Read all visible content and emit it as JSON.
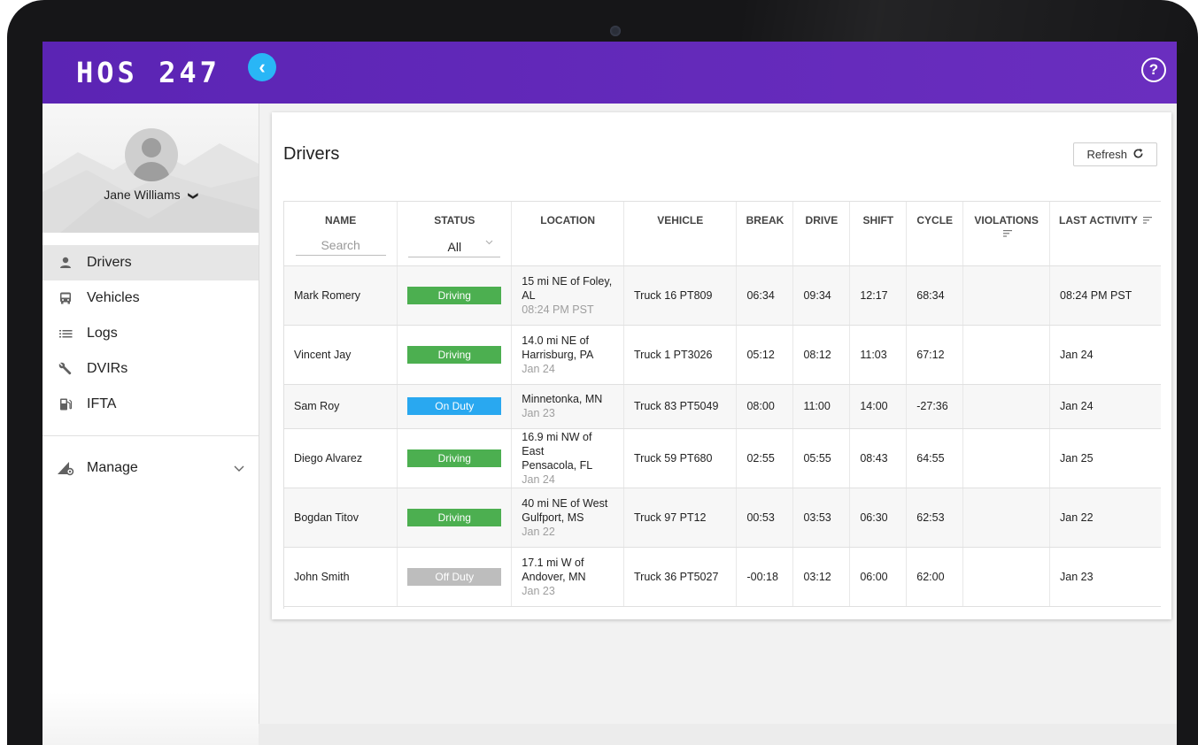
{
  "app": {
    "logo": "HOS 247",
    "colors": {
      "topbar": "#5b24b4",
      "accent": "#29b6f6",
      "driving": "#4caf50",
      "on_duty": "#29a8f0",
      "off_duty": "#bdbdbd"
    }
  },
  "topbar": {
    "collapse_icon": "chevron-left-icon",
    "help_icon": "help-circle-icon",
    "help_glyph": "?"
  },
  "sidebar": {
    "user": {
      "name": "Jane Williams",
      "chevron": "❯"
    },
    "items": [
      {
        "label": "Drivers",
        "icon": "person-icon",
        "active": true
      },
      {
        "label": "Vehicles",
        "icon": "bus-icon",
        "active": false
      },
      {
        "label": "Logs",
        "icon": "list-icon",
        "active": false
      },
      {
        "label": "DVIRs",
        "icon": "wrench-icon",
        "active": false
      },
      {
        "label": "IFTA",
        "icon": "fuel-pump-icon",
        "active": false
      }
    ],
    "manage": {
      "label": "Manage",
      "icon": "manage-icon"
    }
  },
  "page": {
    "title": "Drivers",
    "refresh_label": "Refresh"
  },
  "table": {
    "columns": [
      "NAME",
      "STATUS",
      "LOCATION",
      "VEHICLE",
      "BREAK",
      "DRIVE",
      "SHIFT",
      "CYCLE",
      "VIOLATIONS",
      "LAST ACTIVITY"
    ],
    "name_filter_placeholder": "Search",
    "status_filter_value": "All",
    "rows": [
      {
        "name": "Mark Romery",
        "status": "Driving",
        "status_type": "driving",
        "location": [
          "15 mi NE of Foley,",
          "AL"
        ],
        "location_time": "08:24 PM PST",
        "vehicle": "Truck 16 PT809",
        "break": "06:34",
        "drive": "09:34",
        "shift": "12:17",
        "cycle": "68:34",
        "violations": "",
        "last_activity": "08:24 PM PST"
      },
      {
        "name": "Vincent Jay",
        "status": "Driving",
        "status_type": "driving",
        "location": [
          "14.0 mi NE of",
          "Harrisburg, PA"
        ],
        "location_time": "Jan 24",
        "vehicle": "Truck 1 PT3026",
        "break": "05:12",
        "drive": "08:12",
        "shift": "11:03",
        "cycle": "67:12",
        "violations": "",
        "last_activity": "Jan 24"
      },
      {
        "name": "Sam Roy",
        "status": "On Duty",
        "status_type": "on_duty",
        "location": [
          "Minnetonka, MN"
        ],
        "location_time": "Jan 23",
        "vehicle": "Truck 83 PT5049",
        "break": "08:00",
        "drive": "11:00",
        "shift": "14:00",
        "cycle": "-27:36",
        "violations": "",
        "last_activity": "Jan 24"
      },
      {
        "name": "Diego Alvarez",
        "status": "Driving",
        "status_type": "driving",
        "location": [
          "16.9 mi NW of East",
          "Pensacola, FL"
        ],
        "location_time": "Jan 24",
        "vehicle": "Truck 59 PT680",
        "break": "02:55",
        "drive": "05:55",
        "shift": "08:43",
        "cycle": "64:55",
        "violations": "",
        "last_activity": "Jan 25"
      },
      {
        "name": "Bogdan Titov",
        "status": "Driving",
        "status_type": "driving",
        "location": [
          "40 mi NE of West",
          "Gulfport, MS"
        ],
        "location_time": "Jan 22",
        "vehicle": "Truck 97 PT12",
        "break": "00:53",
        "drive": "03:53",
        "shift": "06:30",
        "cycle": "62:53",
        "violations": "",
        "last_activity": "Jan 22"
      },
      {
        "name": "John Smith",
        "status": "Off Duty",
        "status_type": "off_duty",
        "location": [
          "17.1 mi W of",
          "Andover, MN"
        ],
        "location_time": "Jan 23",
        "vehicle": "Truck 36 PT5027",
        "break": "-00:18",
        "drive": "03:12",
        "shift": "06:00",
        "cycle": "62:00",
        "violations": "",
        "last_activity": "Jan 23"
      }
    ]
  }
}
